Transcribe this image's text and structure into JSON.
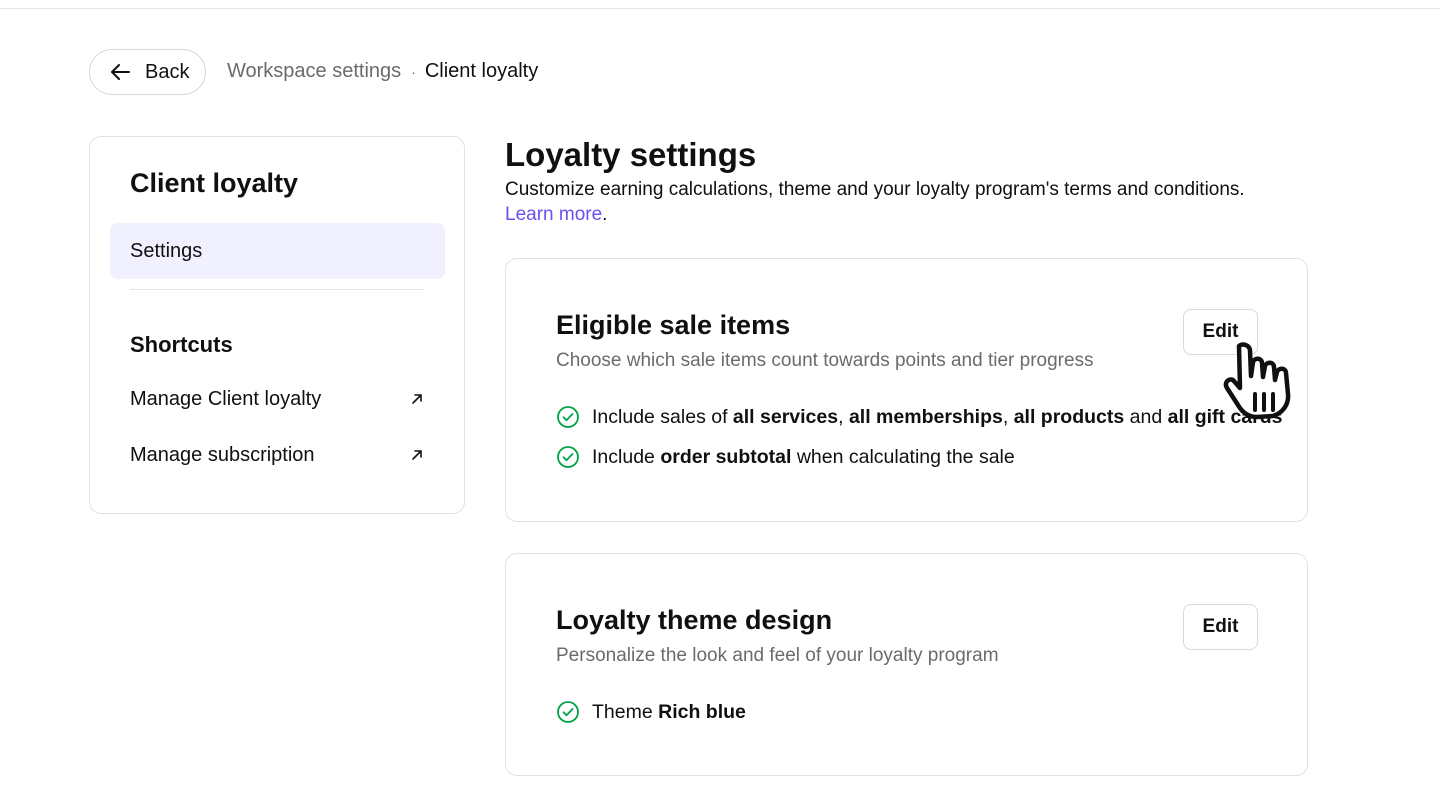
{
  "header": {
    "back_label": "Back",
    "breadcrumb": {
      "parent": "Workspace settings",
      "separator": "·",
      "current": "Client loyalty"
    }
  },
  "sidebar": {
    "title": "Client loyalty",
    "active_item": "Settings",
    "shortcuts_title": "Shortcuts",
    "shortcuts": [
      {
        "label": "Manage Client loyalty",
        "icon": "external-link-arrow-icon"
      },
      {
        "label": "Manage subscription",
        "icon": "external-link-arrow-icon"
      }
    ]
  },
  "main": {
    "title": "Loyalty settings",
    "description": "Customize earning calculations, theme and your loyalty program's terms and conditions.",
    "learn_more": "Learn more",
    "learn_more_suffix": "."
  },
  "cards": {
    "eligible": {
      "title": "Eligible sale items",
      "subtitle": "Choose which sale items count towards points and tier progress",
      "edit_label": "Edit",
      "line1": {
        "t1": "Include sales of ",
        "b1": "all services",
        "t2": ", ",
        "b2": "all memberships",
        "t3": ", ",
        "b3": "all products",
        "t4": " and ",
        "b4": "all gift cards"
      },
      "line2": {
        "t1": "Include ",
        "b1": "order subtotal",
        "t2": " when calculating the sale"
      }
    },
    "theme": {
      "title": "Loyalty theme design",
      "subtitle": "Personalize the look and feel of your loyalty program",
      "edit_label": "Edit",
      "line1": {
        "t1": "Theme ",
        "b1": "Rich blue"
      }
    }
  },
  "colors": {
    "accent": "#6950f3",
    "active_nav_bg": "#f1f0fe",
    "check_green": "#00a34a",
    "muted_text": "#6b6b6b"
  }
}
